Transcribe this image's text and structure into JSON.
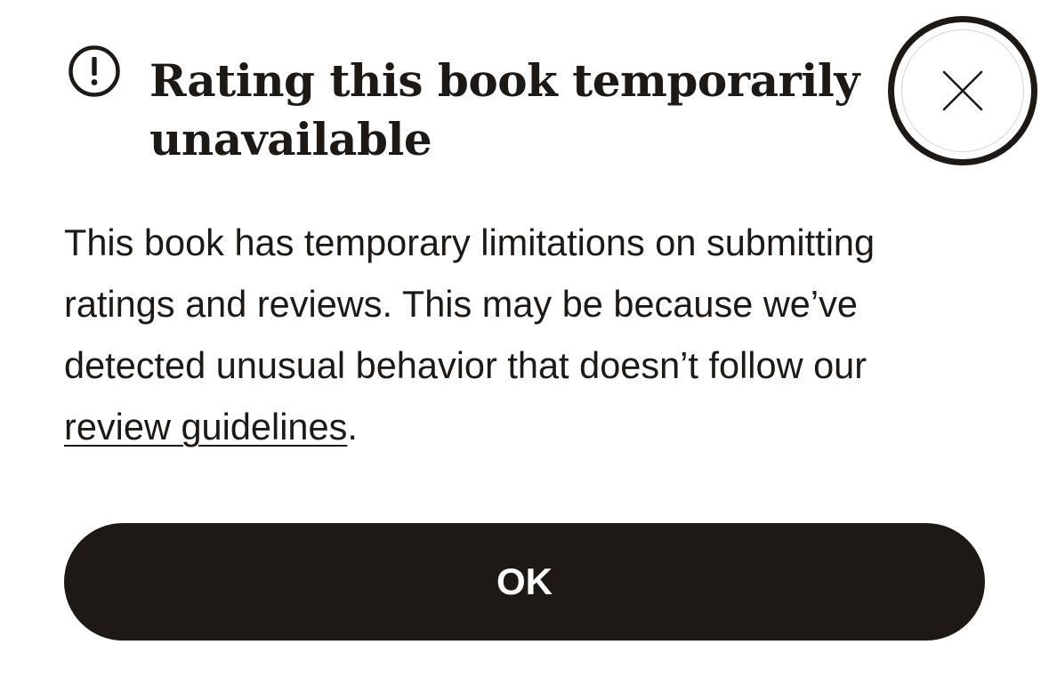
{
  "dialog": {
    "icon": "alert-circle-icon",
    "title": "Rating this book temporarily unavailable",
    "close_icon": "close-icon",
    "body_before_link": "This book has temporary limitations on submitting ratings and reviews. This may be because we’ve detected unusual behavior that doesn’t follow our ",
    "link_label": "review guidelines",
    "body_after_link": ".",
    "ok_label": "OK"
  },
  "colors": {
    "text": "#1e1915",
    "button_bg": "#1e1915",
    "button_text": "#ffffff",
    "background": "#ffffff"
  }
}
